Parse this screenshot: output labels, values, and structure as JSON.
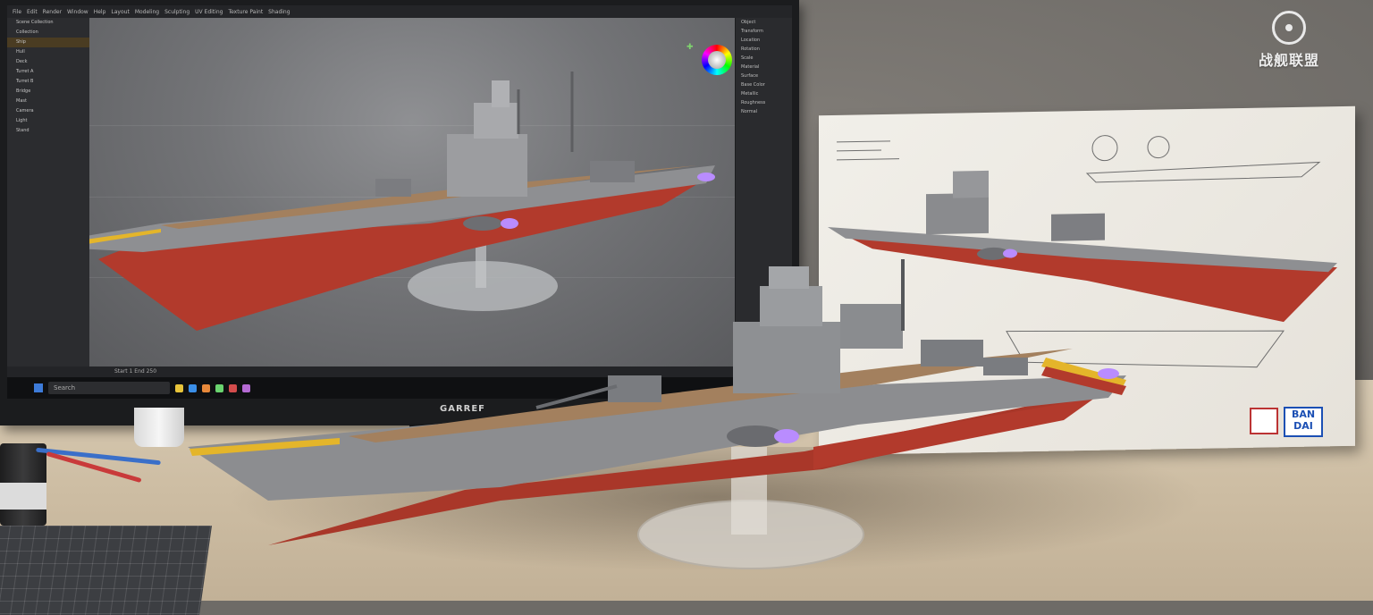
{
  "scene": {
    "watermark_text": "战舰联盟",
    "monitor_brand": "GARREF",
    "box_logo": "BAN\nDAI"
  },
  "software": {
    "menu": [
      "File",
      "Edit",
      "Render",
      "Window",
      "Help",
      "Layout",
      "Modeling",
      "Sculpting",
      "UV Editing",
      "Texture Paint",
      "Shading"
    ],
    "outliner_rows": [
      "Scene Collection",
      "Collection",
      "Ship",
      "Hull",
      "Deck",
      "Turret A",
      "Turret B",
      "Bridge",
      "Mast",
      "Camera",
      "Light",
      "Stand"
    ],
    "props_rows": [
      "Object",
      "Transform",
      "Location",
      "Rotation",
      "Scale",
      "Material",
      "Surface",
      "Base Color",
      "Metallic",
      "Roughness",
      "Normal"
    ],
    "timeline_text": "Start 1  End 250",
    "search_placeholder": "Search"
  },
  "colors": {
    "hull_red": "#b23a2c",
    "hull_grey": "#8e8f92",
    "deck_wood": "#a3805e",
    "engine_glow": "#b98cff",
    "stripe_yellow": "#e4b52a"
  }
}
